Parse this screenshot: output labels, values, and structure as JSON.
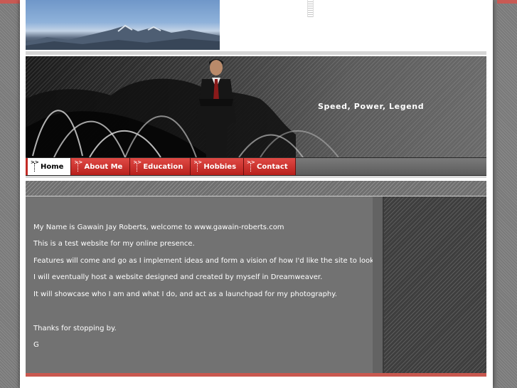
{
  "banner": {
    "tagline": "Speed, Power, Legend"
  },
  "nav": {
    "items": [
      {
        "label": "Home",
        "active": true
      },
      {
        "label": "About Me",
        "active": false
      },
      {
        "label": "Education",
        "active": false
      },
      {
        "label": "Hobbies",
        "active": false
      },
      {
        "label": "Contact",
        "active": false
      }
    ]
  },
  "content": {
    "paragraphs": [
      "My Name is Gawain Jay Roberts, welcome to www.gawain-roberts.com",
      "This is a test website for my online presence.",
      "Features will come and go as I implement ideas and form a vision of how I'd like the site to look.",
      "I will eventually host a website designed and created by myself in Dreamweaver.",
      "It will showcase who I am and what I do, and act as a launchpad for my photography.",
      "Thanks for stopping by.",
      "G"
    ]
  },
  "colors": {
    "accent_red": "#c22b26",
    "content_bg": "#727272",
    "footer_bar": "#c9584f"
  },
  "icons": {
    "nav_marker": "nav-marker-icon"
  }
}
